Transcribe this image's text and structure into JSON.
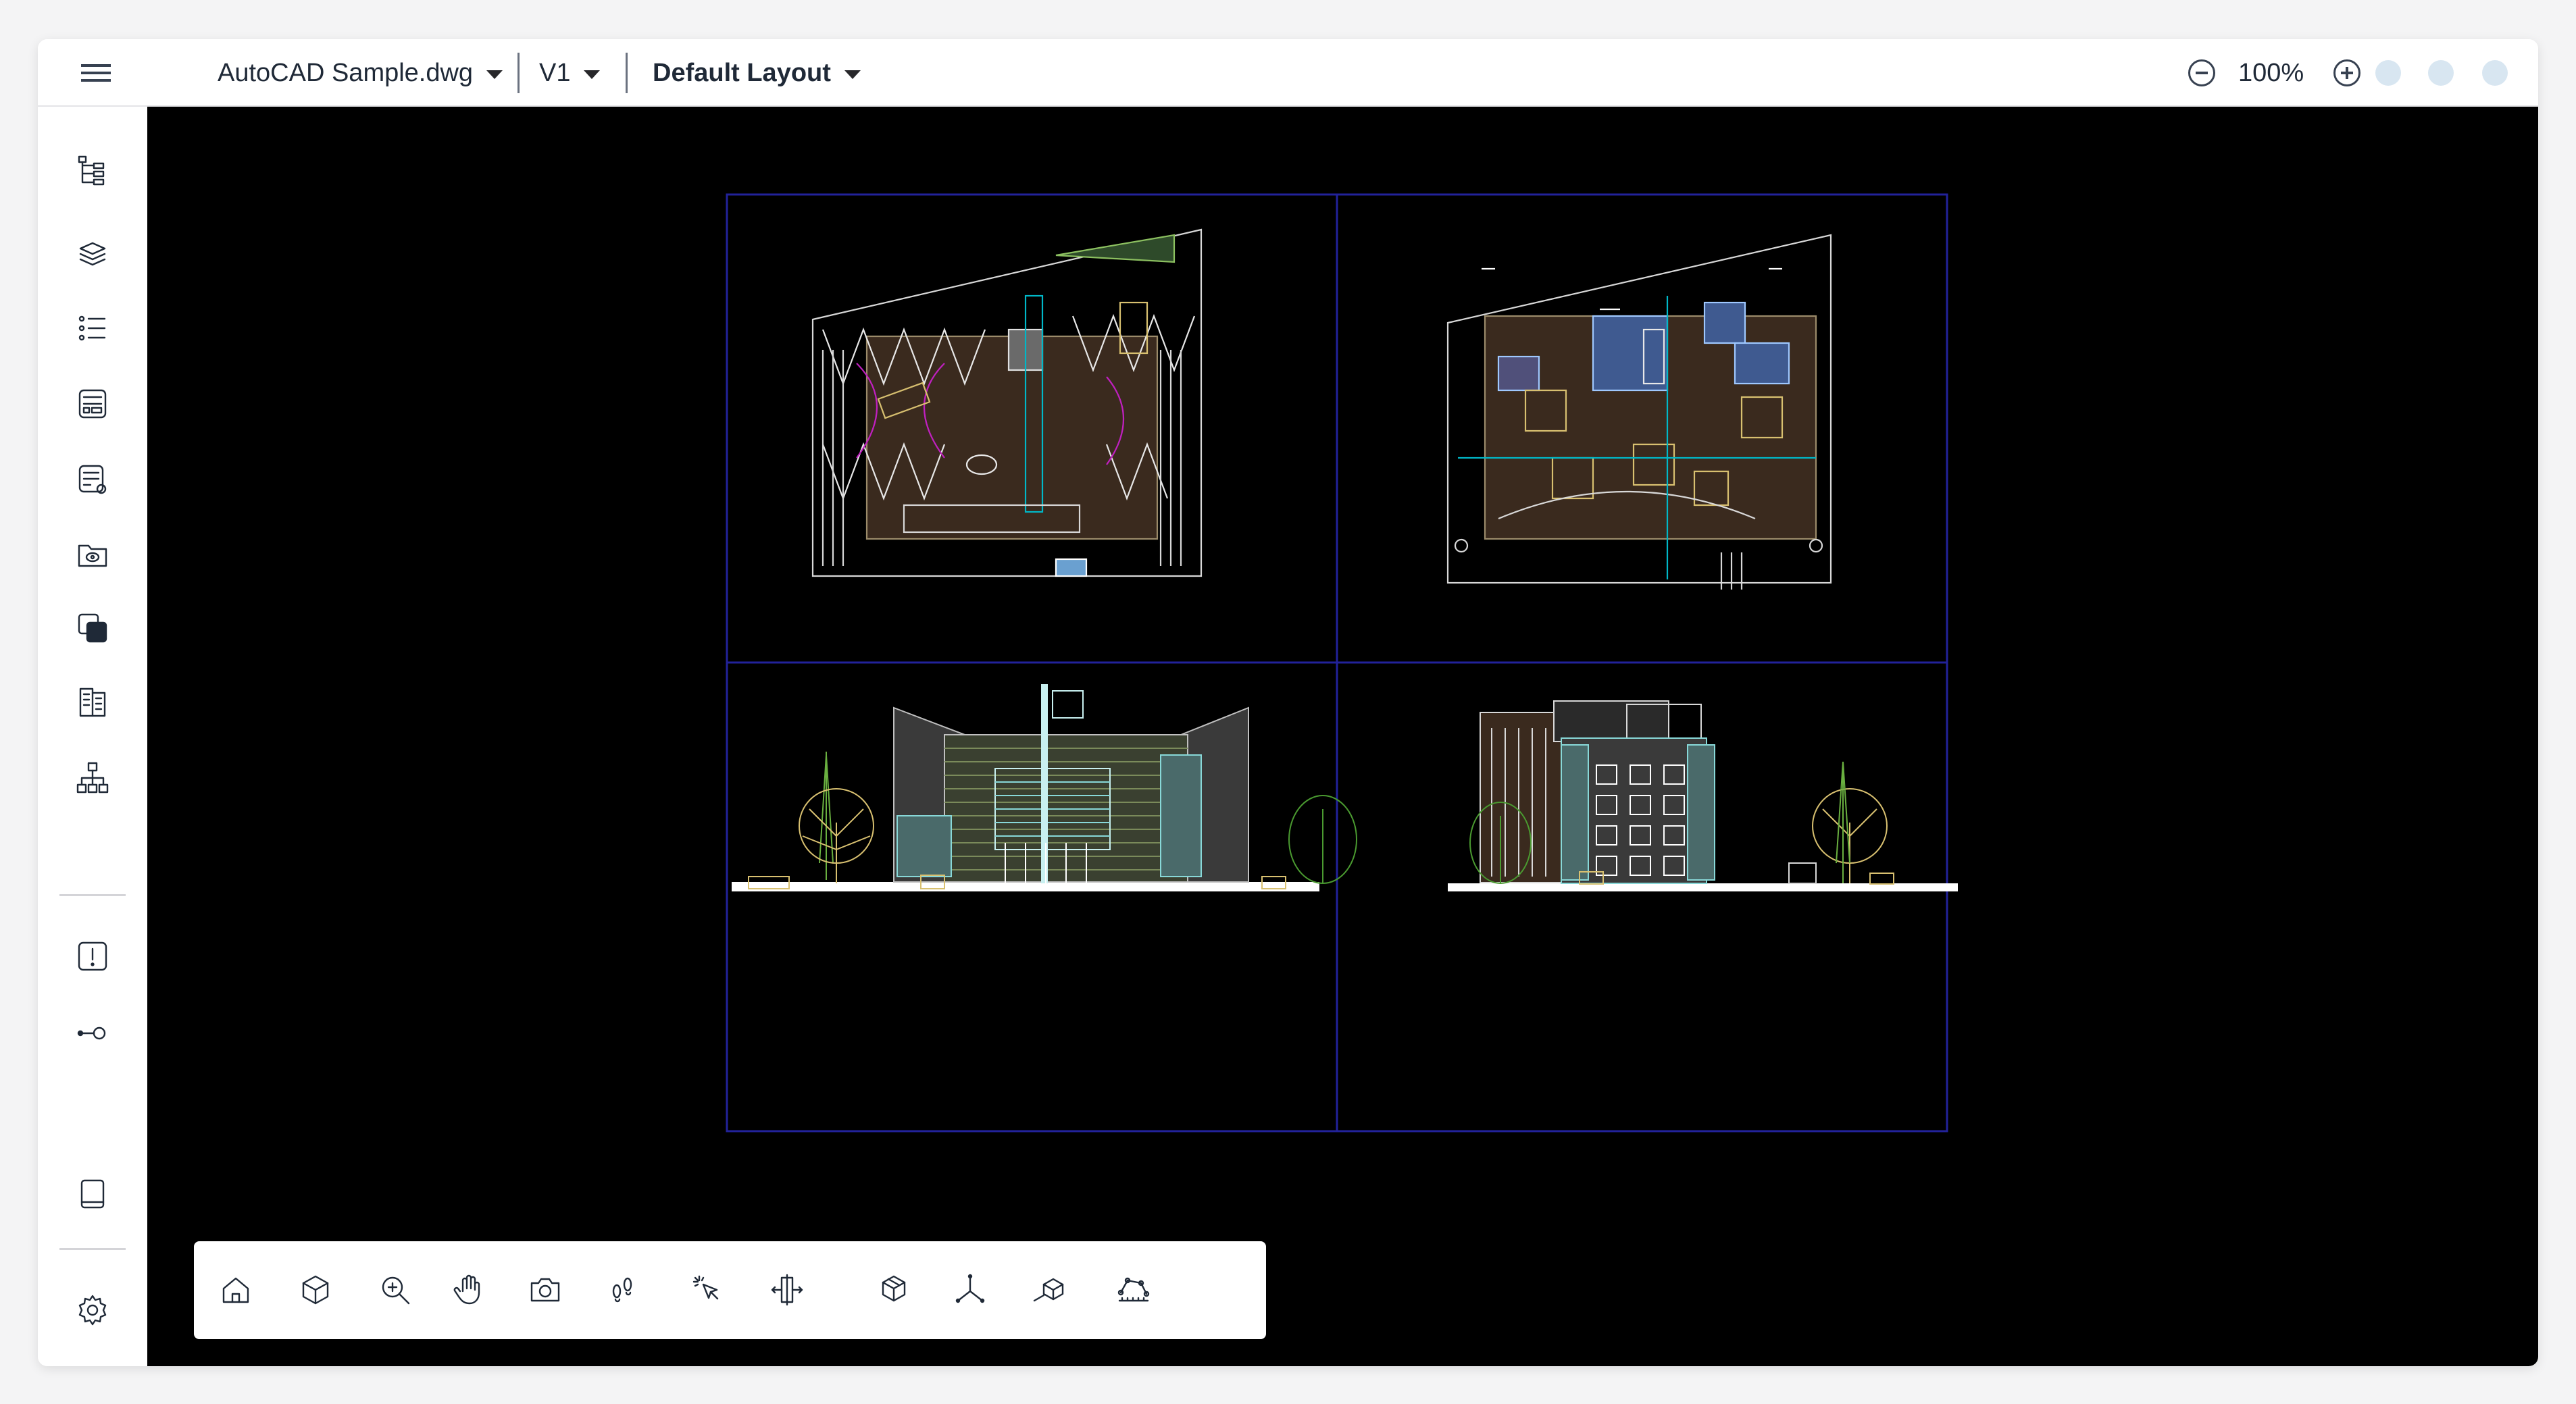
{
  "header": {
    "file_name": "AutoCAD Sample.dwg",
    "version": "V1",
    "layout": "Default Layout",
    "zoom": "100%"
  },
  "sidebar": {
    "items": [
      {
        "icon": "model-tree-icon"
      },
      {
        "icon": "layers-icon"
      },
      {
        "icon": "list-icon"
      },
      {
        "icon": "properties-icon"
      },
      {
        "icon": "property-settings-icon"
      },
      {
        "icon": "saved-views-icon"
      },
      {
        "icon": "overlay-icon"
      },
      {
        "icon": "sheets-icon"
      },
      {
        "icon": "hierarchy-icon"
      },
      {
        "icon": "issues-icon"
      },
      {
        "icon": "connect-icon"
      },
      {
        "icon": "book-icon"
      },
      {
        "icon": "settings-icon"
      }
    ]
  },
  "toolbar": {
    "tools": [
      {
        "icon": "home-icon"
      },
      {
        "icon": "cube-view-icon"
      },
      {
        "icon": "zoom-icon"
      },
      {
        "icon": "pan-hand-icon"
      },
      {
        "icon": "camera-icon"
      },
      {
        "icon": "walk-icon"
      },
      {
        "icon": "select-icon"
      },
      {
        "icon": "section-icon"
      },
      {
        "icon": "explode-icon"
      },
      {
        "icon": "axis-icon"
      },
      {
        "icon": "measure-box-icon"
      },
      {
        "icon": "measure-area-icon"
      }
    ]
  },
  "colors": {
    "viewport_bg": "#000000",
    "frame": "#1e1e8a",
    "accent_dots": "#d8e6f1"
  }
}
